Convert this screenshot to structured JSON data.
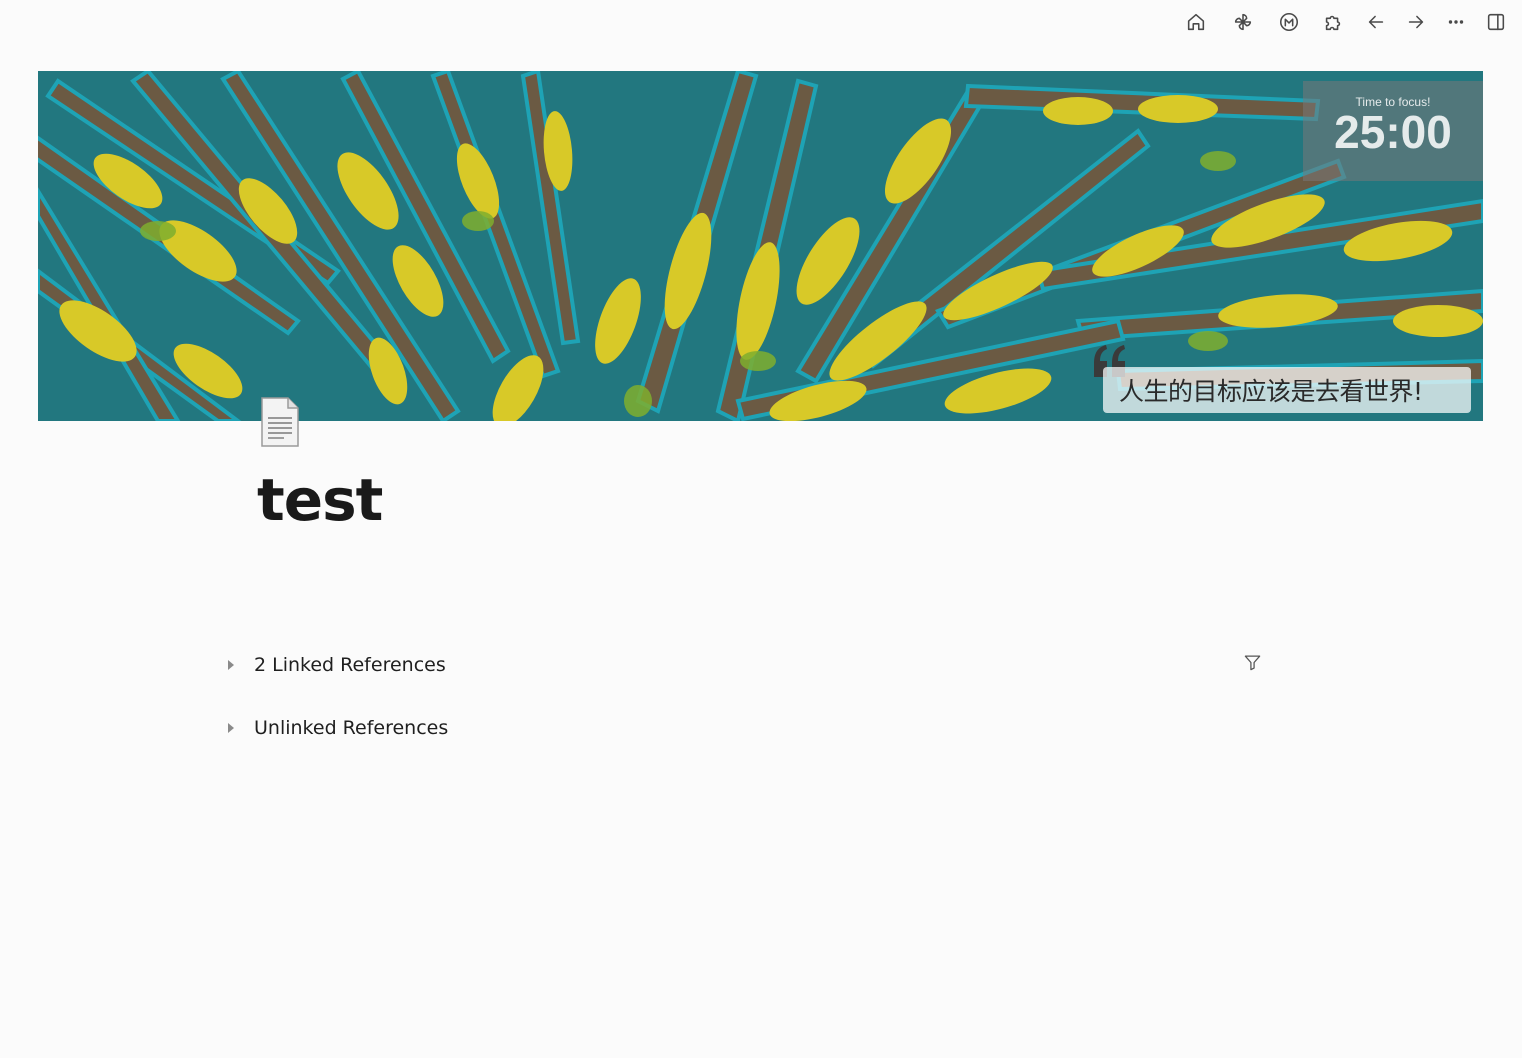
{
  "toolbar": {
    "icons": [
      "home-icon",
      "pinwheel-icon",
      "m-logo-icon",
      "puzzle-icon",
      "arrow-left-icon",
      "arrow-right-icon",
      "more-icon",
      "sidebar-toggle-icon"
    ]
  },
  "banner": {
    "timer_label": "Time to focus!",
    "timer_value": "25:00",
    "quote_text": "人生的目标应该是去看世界!"
  },
  "page": {
    "title": "test",
    "icon": "document-icon"
  },
  "references": {
    "linked_label": "2 Linked References",
    "unlinked_label": "Unlinked References"
  }
}
